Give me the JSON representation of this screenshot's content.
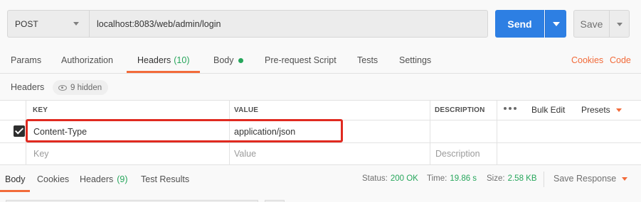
{
  "request": {
    "method": "POST",
    "url": "localhost:8083/web/admin/login",
    "send_label": "Send",
    "save_label": "Save"
  },
  "request_tabs": [
    {
      "label": "Params"
    },
    {
      "label": "Authorization"
    },
    {
      "label": "Headers",
      "count": "(10)"
    },
    {
      "label": "Body"
    },
    {
      "label": "Pre-request Script"
    },
    {
      "label": "Tests"
    },
    {
      "label": "Settings"
    }
  ],
  "links": {
    "cookies": "Cookies",
    "code": "Code"
  },
  "headers_section": {
    "label": "Headers",
    "hidden": "9 hidden"
  },
  "table": {
    "columns": {
      "key": "KEY",
      "value": "VALUE",
      "description": "DESCRIPTION"
    },
    "bulk_edit": "Bulk Edit",
    "presets": "Presets",
    "rows": [
      {
        "key": "Content-Type",
        "value": "application/json",
        "checked": true
      }
    ],
    "placeholders": {
      "key": "Key",
      "value": "Value",
      "description": "Description"
    }
  },
  "response_tabs": [
    {
      "label": "Body"
    },
    {
      "label": "Cookies"
    },
    {
      "label": "Headers",
      "count": "(9)"
    },
    {
      "label": "Test Results"
    }
  ],
  "response_meta": {
    "status_label": "Status:",
    "status_value": "200 OK",
    "time_label": "Time:",
    "time_value": "19.86 s",
    "size_label": "Size:",
    "size_value": "2.58 KB",
    "save_response": "Save Response"
  },
  "colors": {
    "accent_orange": "#f26b3a",
    "send_blue": "#2d7fe3",
    "success_green": "#26a65b",
    "highlight_red": "#e02a20"
  }
}
